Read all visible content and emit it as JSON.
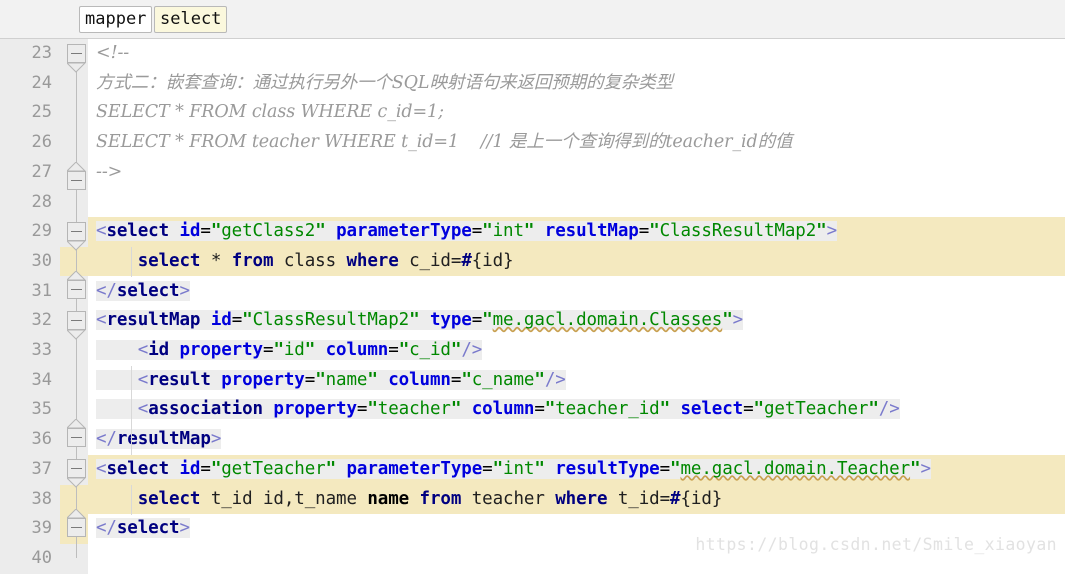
{
  "breadcrumb": {
    "items": [
      {
        "label": "mapper",
        "active": false
      },
      {
        "label": "select",
        "active": true
      }
    ]
  },
  "editor": {
    "first_line": 23,
    "gutter_width": 88,
    "lines": [
      {
        "n": "23",
        "text": "<!--",
        "fold": "open",
        "highlight": "none"
      },
      {
        "n": "24",
        "text": "方式二：嵌套查询：通过执行另外一个SQL映射语句来返回预期的复杂类型",
        "fold": "none",
        "highlight": "none"
      },
      {
        "n": "25",
        "text": "SELECT * FROM class WHERE c_id=1;",
        "fold": "none",
        "highlight": "none"
      },
      {
        "n": "26",
        "text": "SELECT * FROM teacher WHERE t_id=1    //1 是上一个查询得到的teacher_id的值",
        "fold": "none",
        "highlight": "none"
      },
      {
        "n": "27",
        "text": "-->",
        "fold": "close",
        "highlight": "none"
      },
      {
        "n": "28",
        "text": "",
        "fold": "none",
        "highlight": "none"
      },
      {
        "n": "29",
        "text": "<select id=\"getClass2\" parameterType=\"int\" resultMap=\"ClassResultMap2\">",
        "fold": "open",
        "highlight": "band"
      },
      {
        "n": "30",
        "text": "    select * from class where c_id=#{id}",
        "fold": "none",
        "highlight": "band"
      },
      {
        "n": "31",
        "text": "</select>",
        "fold": "close",
        "highlight": "none"
      },
      {
        "n": "32",
        "text": "<resultMap id=\"ClassResultMap2\" type=\"me.gacl.domain.Classes\">",
        "fold": "open",
        "highlight": "none"
      },
      {
        "n": "33",
        "text": "    <id property=\"id\" column=\"c_id\"/>",
        "fold": "none",
        "highlight": "none"
      },
      {
        "n": "34",
        "text": "    <result property=\"name\" column=\"c_name\"/>",
        "fold": "none",
        "highlight": "none"
      },
      {
        "n": "35",
        "text": "    <association property=\"teacher\" column=\"teacher_id\" select=\"getTeacher\"/>",
        "fold": "none",
        "highlight": "none"
      },
      {
        "n": "36",
        "text": "</resultMap>",
        "fold": "close",
        "highlight": "none"
      },
      {
        "n": "37",
        "text": "<select id=\"getTeacher\" parameterType=\"int\" resultType=\"me.gacl.domain.Teacher\">",
        "fold": "open",
        "highlight": "band"
      },
      {
        "n": "38",
        "text": "    select t_id id,t_name name from teacher where t_id=#{id}",
        "fold": "none",
        "highlight": "band"
      },
      {
        "n": "39",
        "text": "</select>",
        "fold": "close",
        "highlight": "none"
      },
      {
        "n": "40",
        "text": "",
        "fold": "none",
        "highlight": "none"
      }
    ]
  },
  "watermark": {
    "text": "https://blog.csdn.net/Smile_xiaoyan"
  },
  "colors": {
    "gutter_bg": "#ececec",
    "editor_bg": "#ffffff",
    "highlight_band": "#f4e9bf",
    "selection_bg": "#ededed",
    "breadcrumb_bg": "#f2f2f2",
    "crumb_active_bg": "#fbf8dd",
    "comment": "#9a9a9a",
    "tag": "#000080",
    "attribute": "#0000dd",
    "value": "#008800",
    "keyword": "#000080",
    "lineno": "#999999",
    "watermark": "#e2e2e2"
  }
}
